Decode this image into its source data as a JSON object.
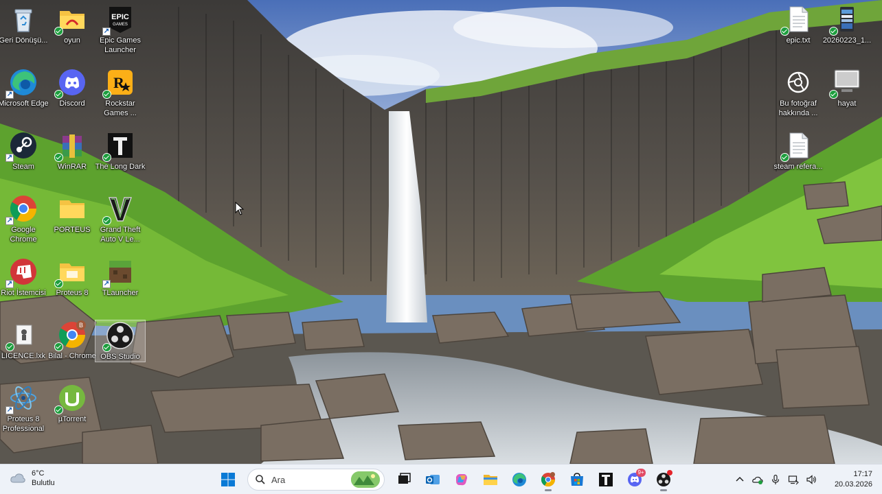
{
  "desktop": {
    "wallpaper": "waterfall-basalt-columns",
    "icons": [
      {
        "id": "recycle-bin",
        "label": "Geri Dönüşü...",
        "icon": "recycle-bin-icon",
        "badge": "none"
      },
      {
        "id": "oyun",
        "label": "oyun",
        "icon": "folder-icon",
        "badge": "sync"
      },
      {
        "id": "epic-games",
        "label": "Epic Games Launcher",
        "icon": "epic-games-icon",
        "badge": "link"
      },
      {
        "id": "edge",
        "label": "Microsoft Edge",
        "icon": "edge-icon",
        "badge": "link"
      },
      {
        "id": "discord",
        "label": "Discord",
        "icon": "discord-icon",
        "badge": "sync"
      },
      {
        "id": "rockstar",
        "label": "Rockstar Games ...",
        "icon": "rockstar-icon",
        "badge": "sync"
      },
      {
        "id": "steam",
        "label": "Steam",
        "icon": "steam-icon",
        "badge": "link"
      },
      {
        "id": "winrar",
        "label": "WinRAR",
        "icon": "winrar-icon",
        "badge": "sync"
      },
      {
        "id": "the-long-dark",
        "label": "The Long Dark",
        "icon": "the-long-dark-icon",
        "badge": "sync"
      },
      {
        "id": "chrome",
        "label": "Google Chrome",
        "icon": "chrome-icon",
        "badge": "link"
      },
      {
        "id": "porteus",
        "label": "PORTEUS",
        "icon": "folder-icon",
        "badge": "none"
      },
      {
        "id": "gta-v",
        "label": "Grand Theft Auto V Le...",
        "icon": "gta-v-icon",
        "badge": "sync"
      },
      {
        "id": "riot",
        "label": "Riot İstemcisi",
        "icon": "riot-icon",
        "badge": "link"
      },
      {
        "id": "proteus-8-folder",
        "label": "Proteus 8",
        "icon": "folder-icon",
        "badge": "sync"
      },
      {
        "id": "tlauncher",
        "label": "TLauncher",
        "icon": "tlauncher-icon",
        "badge": "link"
      },
      {
        "id": "licence",
        "label": "LICENCE.lxk",
        "icon": "licence-file-icon",
        "badge": "sync"
      },
      {
        "id": "bilal-chrome",
        "label": "Bilal - Chrome",
        "icon": "chrome-profile-icon",
        "badge": "sync"
      },
      {
        "id": "obs",
        "label": "OBS Studio",
        "icon": "obs-icon",
        "badge": "sync"
      },
      {
        "id": "proteus-8-pro",
        "label": "Proteus 8 Professional",
        "icon": "proteus-icon",
        "badge": "link"
      },
      {
        "id": "utorrent",
        "label": "µTorrent",
        "icon": "utorrent-icon",
        "badge": "sync"
      },
      {
        "id": "epic-txt",
        "label": "epic.txt",
        "icon": "text-file-icon",
        "badge": "sync"
      },
      {
        "id": "image-file",
        "label": "20260223_1...",
        "icon": "image-file-icon",
        "badge": "sync"
      },
      {
        "id": "about-photo",
        "label": "Bu fotoğraf hakkında ...",
        "icon": "camera-info-icon",
        "badge": "none"
      },
      {
        "id": "hayat",
        "label": "hayat",
        "icon": "monitor-icon",
        "badge": "sync"
      },
      {
        "id": "steam-ref",
        "label": "steam refera...",
        "icon": "text-file-icon",
        "badge": "sync"
      }
    ]
  },
  "taskbar": {
    "weather": {
      "temp": "6°C",
      "condition": "Bulutlu"
    },
    "search_placeholder": "Ara",
    "apps": [
      {
        "id": "start",
        "icon": "windows-start-icon"
      },
      {
        "id": "search"
      },
      {
        "id": "task-view",
        "icon": "task-view-icon"
      },
      {
        "id": "outlook",
        "icon": "outlook-icon"
      },
      {
        "id": "copilot",
        "icon": "copilot-icon"
      },
      {
        "id": "explorer",
        "icon": "file-explorer-icon"
      },
      {
        "id": "edge",
        "icon": "edge-icon"
      },
      {
        "id": "chrome",
        "icon": "chrome-icon",
        "active": true
      },
      {
        "id": "store",
        "icon": "store-icon"
      },
      {
        "id": "the-long-dark",
        "icon": "the-long-dark-icon"
      },
      {
        "id": "discord",
        "icon": "discord-icon",
        "badge": "9+"
      },
      {
        "id": "obs",
        "icon": "obs-icon",
        "active": true
      }
    ],
    "tray": {
      "time": "17:17",
      "date": "20.03.2026"
    }
  },
  "colors": {
    "taskbar_bg": "#eef2f8",
    "accent": "#0078d4",
    "sync_badge": "#1e9e3e"
  }
}
